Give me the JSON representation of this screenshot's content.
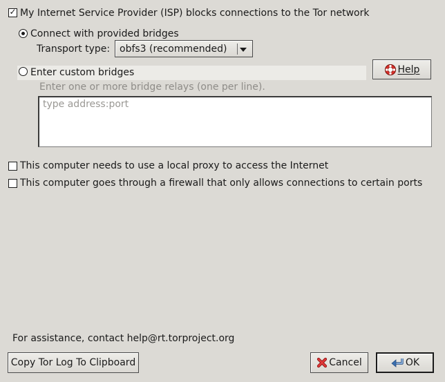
{
  "bridges": {
    "isp_blocks_label": "My Internet Service Provider (ISP) blocks connections to the Tor network",
    "isp_blocks_checked": true,
    "provided_label": "Connect with provided bridges",
    "transport_label": "Transport type:",
    "transport_value": "obfs3 (recommended)",
    "custom_label": "Enter custom bridges",
    "custom_hint": "Enter one or more bridge relays (one per line).",
    "custom_placeholder": "type address:port",
    "help_label": "Help"
  },
  "proxy": {
    "local_proxy_label": "This computer needs to use a local proxy to access the Internet",
    "firewall_label": "This computer goes through a firewall that only allows connections to certain ports"
  },
  "footer": {
    "assistance_text": "For assistance, contact help@rt.torproject.org",
    "copy_log_label": "Copy Tor Log To Clipboard",
    "cancel_label": "Cancel",
    "ok_label": "OK"
  },
  "icons": {
    "isp_check": "check-icon",
    "help": "lifebuoy-icon",
    "cancel": "red-x-icon",
    "ok": "enter-arrow-icon"
  },
  "colors": {
    "background": "#dcdad5",
    "help_icon": "#d8302a",
    "cancel_icon": "#cc2020",
    "ok_icon": "#3a6fb0"
  }
}
